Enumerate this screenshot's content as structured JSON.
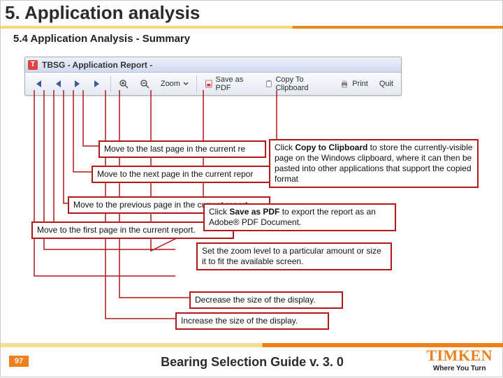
{
  "title": "5. Application analysis",
  "subheading": "5.4 Application Analysis - Summary",
  "app": {
    "window_title": "TBSG - Application Report -",
    "toolbar": {
      "zoom_label": "Zoom",
      "save_pdf_label": "Save as PDF",
      "copy_label": "Copy To Clipboard",
      "print_label": "Print",
      "quit_label": "Quit"
    }
  },
  "callouts": {
    "last_page": "Move to the last page in the current re",
    "next_page": "Move to the next page in the current repor",
    "prev_page": "Move to the previous page in the current report.",
    "first_page": "Move to the first page in the current report.",
    "copy_clip": "Click <b>Copy to Clipboard</b> to store the currently-visible page on the Windows clipboard, where it can then be pasted into other applications that support the copied format",
    "save_pdf": "Click <b>Save as PDF</b> to export the report as an Adobe® PDF Document.",
    "zoom_set": "Set the zoom level to a particular amount or size it to fit the available screen.",
    "zoom_dec": "Decrease the size of the display.",
    "zoom_inc": "Increase the size of the display."
  },
  "footer": {
    "page_number": "97",
    "doc_title": "Bearing Selection Guide v. 3. 0",
    "brand_name": "TIMKEN",
    "brand_tag": "Where You Turn"
  }
}
